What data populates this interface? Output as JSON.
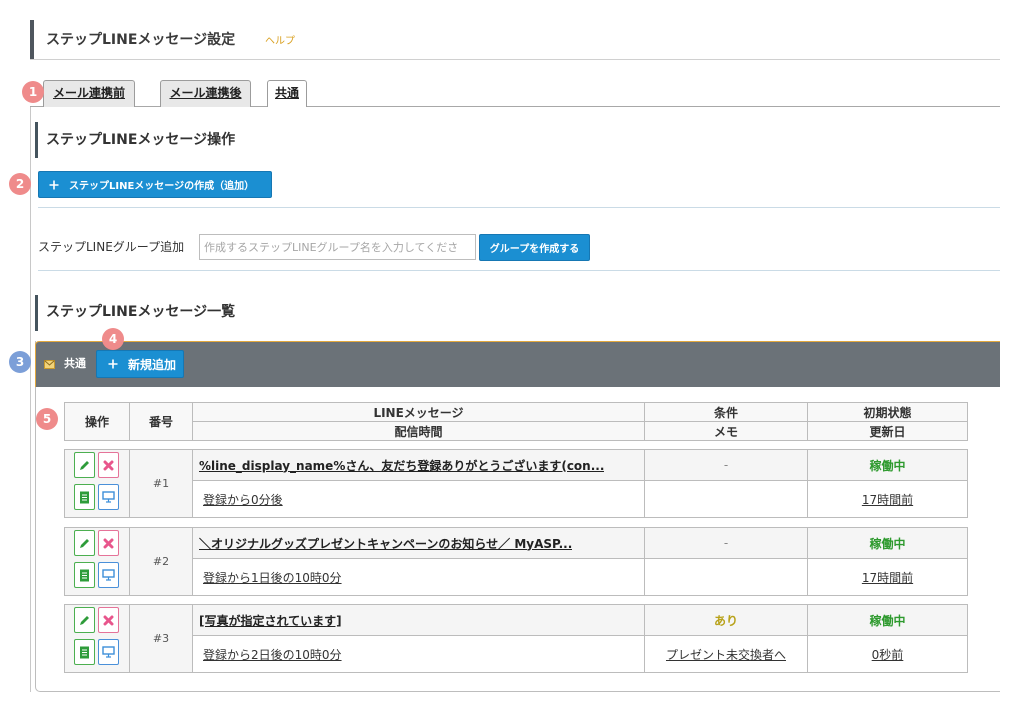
{
  "header": {
    "title": "ステップLINEメッセージ設定",
    "help_link": "ヘルプ"
  },
  "tabs": [
    {
      "label": "メール連携前",
      "active": false
    },
    {
      "label": "メール連携後",
      "active": false
    },
    {
      "label": "共通",
      "active": true
    }
  ],
  "guide_badges": [
    "1",
    "2",
    "3",
    "4",
    "5"
  ],
  "operations": {
    "title": "ステップLINEメッセージ操作",
    "create_button": {
      "icon": "plus-icon",
      "label": "ステップLINEメッセージの作成（追加）"
    }
  },
  "group_add": {
    "label": "ステップLINEグループ追加",
    "input_value": "",
    "placeholder": "作成するステップLINEグループ名を入力してくださ",
    "button": "グループを作成する"
  },
  "list": {
    "title": "ステップLINEメッセージ一覧",
    "group": {
      "icon": "envelope-icon",
      "name": "共通",
      "add_button": {
        "icon": "plus-icon",
        "label": "新規追加"
      }
    },
    "columns": {
      "operations": "操作",
      "number": "番号",
      "message": "LINEメッセージ",
      "delivery_time": "配信時間",
      "condition": "条件",
      "memo": "メモ",
      "initial_status": "初期状態",
      "updated": "更新日"
    },
    "row_actions": [
      "pencil-icon",
      "delete-icon",
      "document-icon",
      "monitor-icon"
    ],
    "rows": [
      {
        "number": "#1",
        "message": "%line_display_name%さん、友だち登録ありがとうございます(con...",
        "condition": "-",
        "status": "稼働中",
        "delivery_time": "登録から0分後",
        "memo": "",
        "updated": "17時間前"
      },
      {
        "number": "#2",
        "message": "＼オリジナルグッズプレゼントキャンペーンのお知らせ／ MyASP...",
        "condition": "-",
        "status": "稼働中",
        "delivery_time": "登録から1日後の10時0分",
        "memo": "",
        "updated": "17時間前"
      },
      {
        "number": "#3",
        "message": "[写真が指定されています]",
        "condition": "あり",
        "status": "稼働中",
        "delivery_time": "登録から2日後の10時0分",
        "memo": "プレゼント未交換者へ",
        "updated": "0秒前"
      }
    ]
  },
  "colors": {
    "accent": "#1b8fd2",
    "badge_pink": "#ef8b8b",
    "badge_blue": "#7c9fd8",
    "status_active": "#2e9a2e",
    "condition_set": "#b8a21a",
    "help_link": "#d9a020",
    "group_bar": "#6b7278",
    "group_border": "#e3a93e"
  }
}
